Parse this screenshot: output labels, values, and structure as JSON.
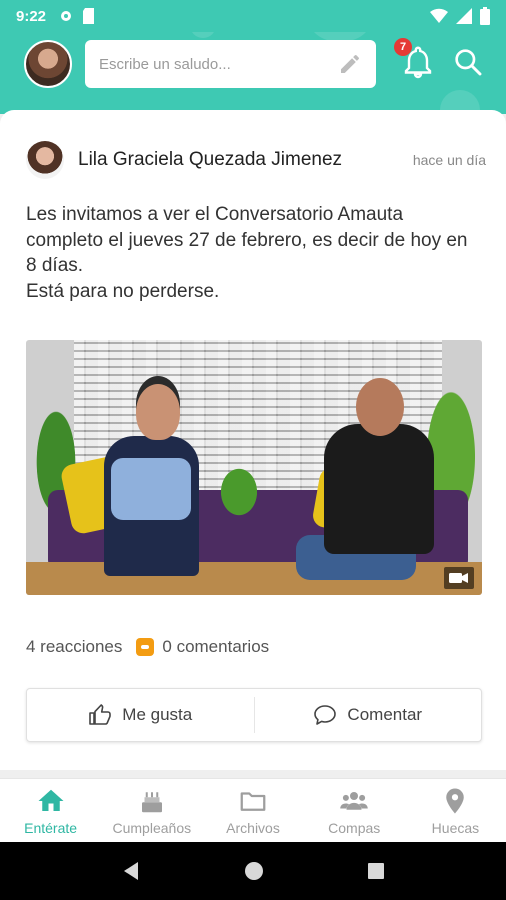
{
  "status_bar": {
    "time": "9:22"
  },
  "header": {
    "greeting_placeholder": "Escribe un saludo...",
    "notification_count": "7"
  },
  "post": {
    "author": "Lila Graciela Quezada Jimenez",
    "time": "hace un día",
    "text": "Les invitamos a ver el Conversatorio Amauta completo el jueves 27 de febrero, es decir de hoy en 8 días.\nEstá para no perderse.",
    "reactions": "4 reacciones",
    "comments": "0 comentarios",
    "like_label": "Me gusta",
    "comment_label": "Comentar"
  },
  "bottom_nav": {
    "items": [
      {
        "label": "Entérate",
        "icon": "home-icon",
        "active": true
      },
      {
        "label": "Cumpleaños",
        "icon": "cake-icon",
        "active": false
      },
      {
        "label": "Archivos",
        "icon": "folder-icon",
        "active": false
      },
      {
        "label": "Compas",
        "icon": "group-icon",
        "active": false
      },
      {
        "label": "Huecas",
        "icon": "location-pin-icon",
        "active": false
      }
    ]
  },
  "colors": {
    "brand": "#3ec9b3",
    "active_nav": "#2fb7a3",
    "badge": "#e53935",
    "comment_badge": "#f39c12"
  }
}
